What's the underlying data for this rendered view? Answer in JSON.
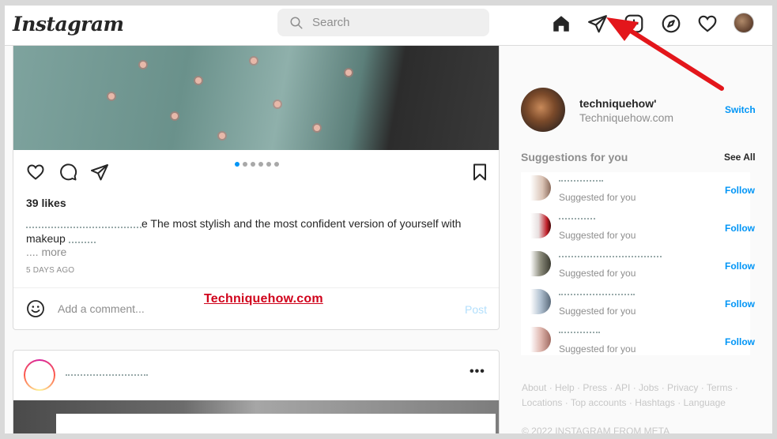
{
  "header": {
    "logo": "Instagram",
    "search": {
      "placeholder": "Search"
    }
  },
  "post1": {
    "likes": "39 likes",
    "caption_tail": "e The most stylish and the most confident version of yourself with",
    "caption_line2": "makeup",
    "more": ".... more",
    "age": "5 DAYS AGO",
    "comment_placeholder": "Add a comment...",
    "post_label": "Post",
    "carousel_count": 6,
    "carousel_active": 1
  },
  "watermark": "Techniquehow.com",
  "post2": {
    "more": "•••"
  },
  "sidebar": {
    "username": "techniquehow'",
    "fullname": "Techniquehow.com",
    "switch_label": "Switch",
    "suggestions_title": "Suggestions for you",
    "see_all": "See All",
    "suggestions": [
      {
        "subtitle": "Suggested for you",
        "follow": "Follow"
      },
      {
        "subtitle": "Suggested for you",
        "follow": "Follow"
      },
      {
        "subtitle": "Suggested for you",
        "follow": "Follow"
      },
      {
        "subtitle": "Suggested for you",
        "follow": "Follow"
      },
      {
        "subtitle": "Suggested for you",
        "follow": "Follow"
      }
    ],
    "footer_line1": "About · Help · Press · API · Jobs · Privacy · Terms ·",
    "footer_line2": "Locations · Top accounts · Hashtags · Language",
    "copyright": "© 2022 INSTAGRAM FROM META"
  },
  "colors": {
    "accent": "#0095f6",
    "annotation_arrow": "#e3161b",
    "watermark": "#d0021b"
  }
}
